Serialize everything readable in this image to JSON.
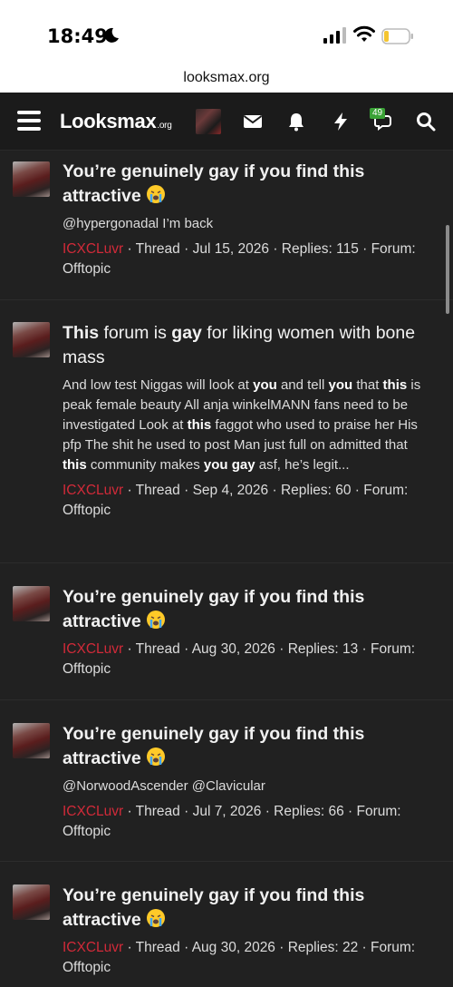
{
  "status": {
    "time": "18:49"
  },
  "browser": {
    "url": "looksmax.org"
  },
  "nav": {
    "logo_main": "Looksmax",
    "logo_suffix": ".org",
    "alerts_badge": "49"
  },
  "items": [
    {
      "title_bold": "You’re genuinely gay if you find this attractive",
      "has_emoji": true,
      "snippet": "@hypergonadal I’m back",
      "author": "ICXCLuvr",
      "meta_rest": " · Thread · Jul 15, 2026 · Replies: 115 · Forum: Offtopic"
    },
    {
      "t1": "This",
      "t2": " forum is ",
      "t3": "gay",
      "t4": " for liking women with bone mass",
      "s1": "And low test Niggas will look at ",
      "s2": "you",
      "s3": " and tell ",
      "s4": "you",
      "s5": " that ",
      "s6": "this",
      "s7": " is peak female beauty All anja winkelMANN fans need to be investigated Look at ",
      "s8": "this",
      "s9": " faggot who used to praise her His pfp The shit he used to post Man just full on admitted that ",
      "s10": "this",
      "s11": " community makes ",
      "s12": "you gay",
      "s13": " asf, he’s legit...",
      "author": "ICXCLuvr",
      "meta_rest": " · Thread · Sep 4, 2026 · Replies: 60 · Forum: Offtopic"
    },
    {
      "title_bold": "You’re genuinely gay if you find this attractive",
      "has_emoji": true,
      "author": "ICXCLuvr",
      "meta_rest": " · Thread · Aug 30, 2026 · Replies: 13 · Forum: Offtopic"
    },
    {
      "title_bold": "You’re genuinely gay if you find this attractive",
      "has_emoji": true,
      "snippet": "@NorwoodAscender @Clavicular",
      "author": "ICXCLuvr",
      "meta_rest": " · Thread · Jul 7, 2026 · Replies: 66 · Forum: Offtopic"
    },
    {
      "title_bold": "You’re genuinely gay if you find this attractive",
      "has_emoji": true,
      "author": "ICXCLuvr",
      "meta_rest": " · Thread · Aug 30, 2026 · Replies: 22 · Forum: Offtopic"
    }
  ],
  "colors": {
    "background": "#212121",
    "author": "#d12a39",
    "badge": "#3aa236",
    "nav": "#1b1b1b"
  },
  "icons": [
    "moon-icon",
    "signal-icon",
    "wifi-icon",
    "battery-icon",
    "menu-icon",
    "envelope-icon",
    "bell-icon",
    "bolt-icon",
    "chat-icon",
    "search-icon",
    "loudly-crying-emoji"
  ]
}
